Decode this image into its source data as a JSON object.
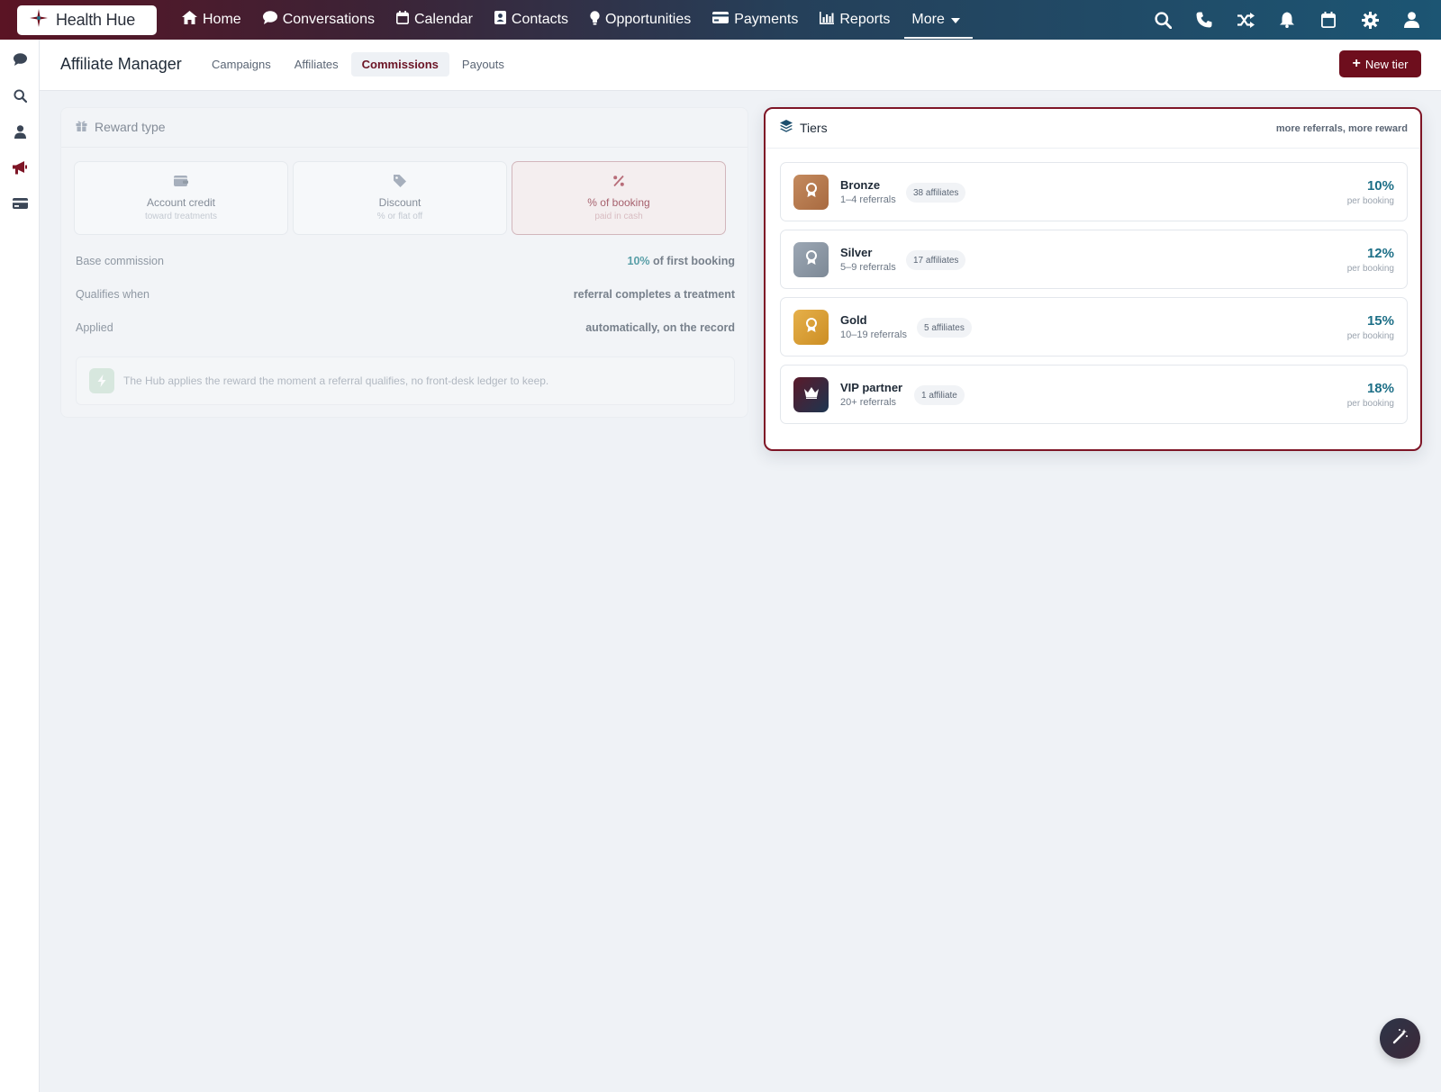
{
  "brand": {
    "name": "Health Hue"
  },
  "nav": {
    "items": [
      {
        "label": "Home",
        "icon": "home-icon"
      },
      {
        "label": "Conversations",
        "icon": "chat-bubble-icon"
      },
      {
        "label": "Calendar",
        "icon": "calendar-icon"
      },
      {
        "label": "Contacts",
        "icon": "contact-card-icon"
      },
      {
        "label": "Opportunities",
        "icon": "lightbulb-icon"
      },
      {
        "label": "Payments",
        "icon": "credit-card-icon"
      },
      {
        "label": "Reports",
        "icon": "bar-chart-icon"
      }
    ],
    "more_label": "More",
    "right_icons": [
      "search-icon",
      "phone-icon",
      "shuffle-icon",
      "bell-icon",
      "calendar-icon",
      "gear-icon",
      "user-icon"
    ]
  },
  "rail": {
    "icons": [
      "chat-bubble-icon",
      "search-icon",
      "user-icon",
      "megaphone-icon",
      "credit-card-icon"
    ]
  },
  "header": {
    "title": "Affiliate Manager",
    "tabs": [
      "Campaigns",
      "Affiliates",
      "Commissions",
      "Payouts"
    ],
    "active_tab": "Commissions",
    "new_tier_label": "New tier"
  },
  "reward": {
    "title": "Reward type",
    "options": [
      {
        "label": "Account credit",
        "sub": "toward treatments",
        "icon": "wallet-icon",
        "selected": false
      },
      {
        "label": "Discount",
        "sub": "% or flat off",
        "icon": "tag-icon",
        "selected": false
      },
      {
        "label": "% of booking",
        "sub": "paid in cash",
        "icon": "percent-icon",
        "selected": true
      }
    ],
    "rows": [
      {
        "key": "Base commission",
        "value_accent": "10%",
        "value": "of first booking"
      },
      {
        "key": "Qualifies when",
        "value": "referral completes a treatment"
      },
      {
        "key": "Applied",
        "value": "automatically, on the record"
      }
    ],
    "note": "The Hub applies the reward the moment a referral qualifies, no front-desk ledger to keep."
  },
  "tiers": {
    "title": "Tiers",
    "subtitle": "more referrals, more reward",
    "items": [
      {
        "name": "Bronze",
        "referrals": "1–4 referrals",
        "affiliates": "38 affiliates",
        "rate": "10%",
        "per": "per booking",
        "color": "#b87a4f",
        "icon": "award-icon"
      },
      {
        "name": "Silver",
        "referrals": "5–9 referrals",
        "affiliates": "17 affiliates",
        "rate": "12%",
        "per": "per booking",
        "color": "#8e9aa8",
        "icon": "award-icon"
      },
      {
        "name": "Gold",
        "referrals": "10–19 referrals",
        "affiliates": "5 affiliates",
        "rate": "15%",
        "per": "per booking",
        "color": "#dba13a",
        "icon": "award-icon"
      },
      {
        "name": "VIP partner",
        "referrals": "20+ referrals",
        "affiliates": "1 affiliate",
        "rate": "18%",
        "per": "per booking",
        "color": "#3a1f2e",
        "icon": "crown-icon"
      }
    ]
  },
  "colors": {
    "accent": "#6e0e1d",
    "rate": "#1d6f87"
  },
  "fab": {
    "icon": "magic-wand-icon"
  }
}
